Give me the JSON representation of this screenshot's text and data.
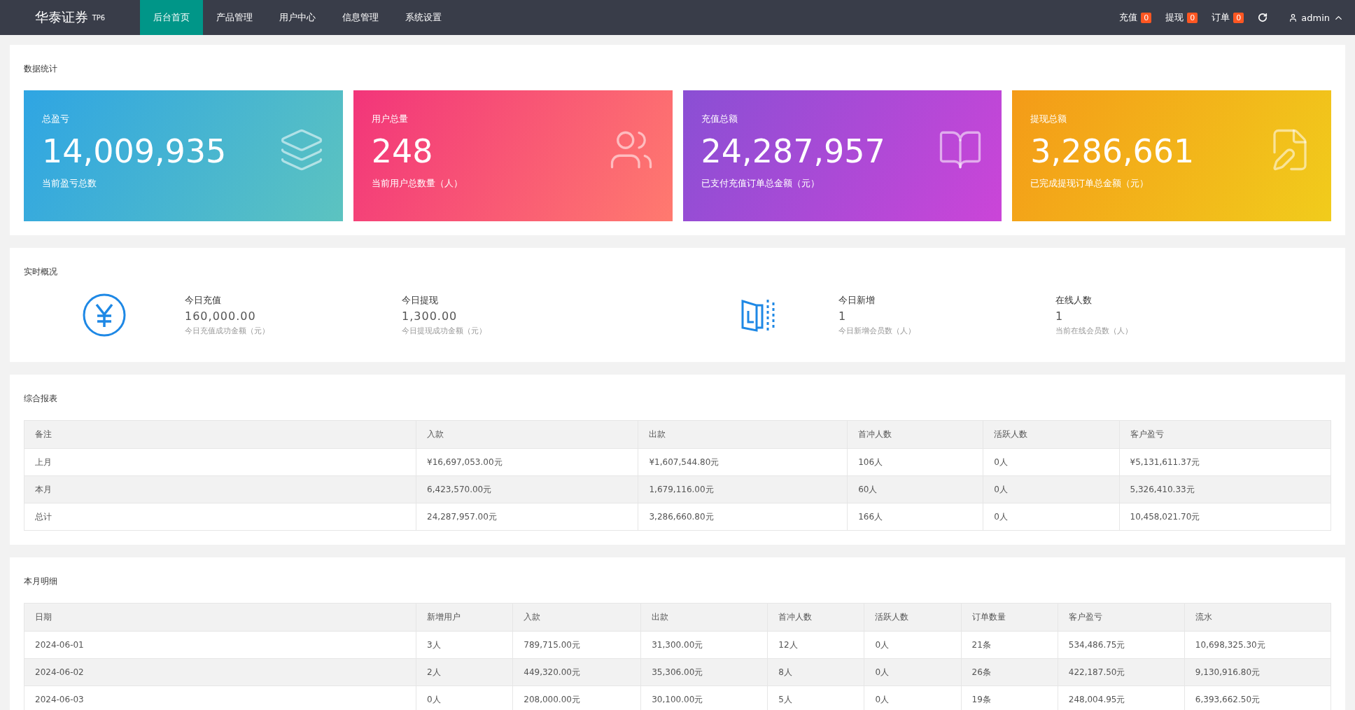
{
  "brand": {
    "name": "华泰证券",
    "sup": "TP6"
  },
  "nav": [
    {
      "label": "后台首页",
      "selected": true
    },
    {
      "label": "产品管理",
      "selected": false
    },
    {
      "label": "用户中心",
      "selected": false
    },
    {
      "label": "信息管理",
      "selected": false
    },
    {
      "label": "系统设置",
      "selected": false
    }
  ],
  "top_right": {
    "badges": [
      {
        "label": "充值",
        "count": "0"
      },
      {
        "label": "提现",
        "count": "0"
      },
      {
        "label": "订单",
        "count": "0"
      }
    ],
    "user": "admin"
  },
  "stats": {
    "title": "数据统计",
    "cards": [
      {
        "kind": "layers",
        "label": "总盈亏",
        "value": "14,009,935",
        "note": "当前盈亏总数"
      },
      {
        "kind": "users",
        "label": "用户总量",
        "value": "248",
        "note": "当前用户总数量（人）"
      },
      {
        "kind": "book",
        "label": "充值总额",
        "value": "24,287,957",
        "note": "已支付充值订单总金额（元）"
      },
      {
        "kind": "file",
        "label": "提现总额",
        "value": "3,286,661",
        "note": "已完成提现订单总金额（元）"
      }
    ]
  },
  "realtime": {
    "title": "实时概况",
    "groups": [
      {
        "kind": "yen",
        "items": [
          {
            "label": "今日充值",
            "value": "160,000.00",
            "note": "今日充值成功金额（元）"
          },
          {
            "label": "今日提现",
            "value": "1,300.00",
            "note": "今日提现成功金额（元）"
          }
        ]
      },
      {
        "kind": "door",
        "items": [
          {
            "label": "今日新增",
            "value": "1",
            "note": "今日新增会员数（人）"
          },
          {
            "label": "在线人数",
            "value": "1",
            "note": "当前在线会员数（人）"
          }
        ]
      }
    ]
  },
  "report": {
    "title": "综合报表",
    "columns": [
      "备注",
      "入款",
      "出款",
      "首冲人数",
      "活跃人数",
      "客户盈亏"
    ],
    "rows": [
      [
        "上月",
        "¥16,697,053.00元",
        "¥1,607,544.80元",
        "106人",
        "0人",
        "¥5,131,611.37元"
      ],
      [
        "本月",
        "6,423,570.00元",
        "1,679,116.00元",
        "60人",
        "0人",
        "5,326,410.33元"
      ],
      [
        "总计",
        "24,287,957.00元",
        "3,286,660.80元",
        "166人",
        "0人",
        "10,458,021.70元"
      ]
    ]
  },
  "detail": {
    "title": "本月明细",
    "columns": [
      "日期",
      "新增用户",
      "入款",
      "出款",
      "首冲人数",
      "活跃人数",
      "订单数量",
      "客户盈亏",
      "流水"
    ],
    "rows": [
      [
        "2024-06-01",
        "3人",
        "789,715.00元",
        "31,300.00元",
        "12人",
        "0人",
        "21条",
        "534,486.75元",
        "10,698,325.30元"
      ],
      [
        "2024-06-02",
        "2人",
        "449,320.00元",
        "35,306.00元",
        "8人",
        "0人",
        "26条",
        "422,187.50元",
        "9,130,916.80元"
      ],
      [
        "2024-06-03",
        "0人",
        "208,000.00元",
        "30,100.00元",
        "5人",
        "0人",
        "19条",
        "248,004.95元",
        "6,393,662.50元"
      ]
    ]
  }
}
